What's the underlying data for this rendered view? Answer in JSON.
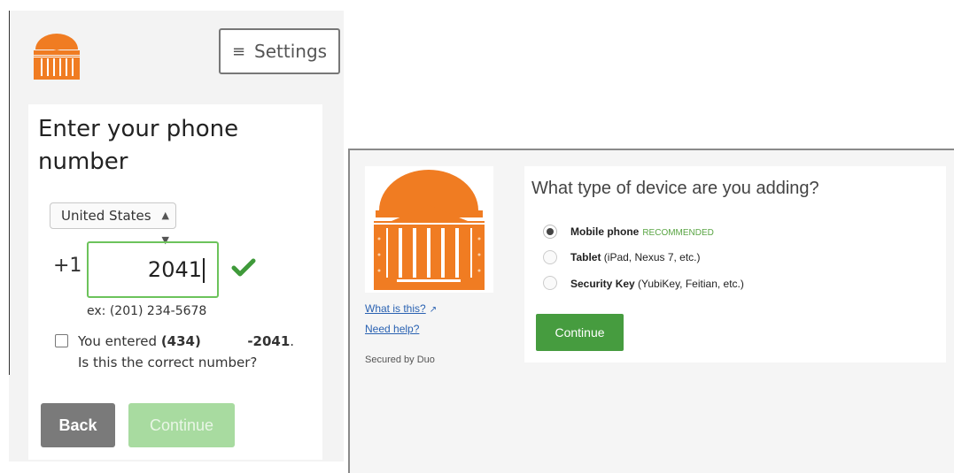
{
  "left": {
    "settings_label": "Settings",
    "title": "Enter your phone number",
    "country": "United States",
    "country_code": "+1",
    "phone_value": "2041",
    "example": "ex: (201) 234-5678",
    "confirm_prefix": "You entered ",
    "confirm_area": "(434)",
    "confirm_suffix": "-2041",
    "confirm_tail": ". Is this the correct number?",
    "back_label": "Back",
    "continue_label": "Continue"
  },
  "right": {
    "what_is_this": "What is this?",
    "need_help": "Need help?",
    "secured_by": "Secured by Duo",
    "title": "What type of device are you adding?",
    "options": [
      {
        "label": "Mobile phone",
        "tag": "RECOMMENDED",
        "detail": "",
        "selected": true
      },
      {
        "label": "Tablet",
        "tag": "",
        "detail": "(iPad, Nexus 7, etc.)",
        "selected": false
      },
      {
        "label": "Security Key",
        "tag": "",
        "detail": "(YubiKey, Feitian, etc.)",
        "selected": false
      }
    ],
    "continue_label": "Continue"
  },
  "colors": {
    "brand_orange": "#f07c22",
    "success_green": "#3f9a3a",
    "duo_button_green": "#469c3f",
    "link_blue": "#2a62b2"
  },
  "icons": [
    "menu-icon",
    "select-arrows-icon",
    "checkmark-icon",
    "external-link-icon",
    "rotunda-logo"
  ]
}
